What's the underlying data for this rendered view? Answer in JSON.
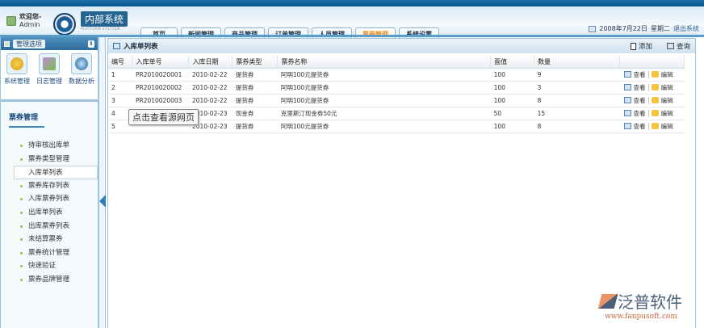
{
  "header": {
    "welcome": "欢迎您-",
    "user": "Admin",
    "system_title": "内部系统",
    "system_subtitle": "PLATFORM SYSYTEM",
    "date": "2008年7月22日",
    "weekday": "星期二",
    "logout": "退出系统"
  },
  "tabs": [
    {
      "label": "首页"
    },
    {
      "label": "新闻管理"
    },
    {
      "label": "商品管理"
    },
    {
      "label": "订单管理"
    },
    {
      "label": "人员管理"
    },
    {
      "label": "票券管理",
      "active": true
    },
    {
      "label": "系统设置"
    }
  ],
  "sidebar": {
    "title": "管理选项",
    "quick": [
      {
        "label": "系统管理"
      },
      {
        "label": "日志管理"
      },
      {
        "label": "数据分析"
      }
    ],
    "section": "票券管理",
    "items": [
      {
        "label": "待审核出库单"
      },
      {
        "label": "票券类型管理"
      },
      {
        "label": "入库单列表",
        "selected": true
      },
      {
        "label": "票券库存列表"
      },
      {
        "label": "入库票券列表"
      },
      {
        "label": "出库单列表"
      },
      {
        "label": "出库票券列表"
      },
      {
        "label": "未结算票券"
      },
      {
        "label": "票券统计管理"
      },
      {
        "label": "快速验证"
      },
      {
        "label": "票券品牌管理"
      }
    ]
  },
  "panel": {
    "title": "入库单列表",
    "add": "添加",
    "query": "查询",
    "view": "查看",
    "edit": "编辑",
    "columns": [
      "编号",
      "入库单号",
      "入库日期",
      "票券类型",
      "票券名称",
      "面值",
      "数量",
      ""
    ],
    "rows": [
      [
        "1",
        "PR2010020001",
        "2010-02-22",
        "提货券",
        "阿明100元提货券",
        "100",
        "9"
      ],
      [
        "2",
        "PR2010020002",
        "2010-02-22",
        "提货券",
        "阿明100元提货券",
        "100",
        "3"
      ],
      [
        "3",
        "PR2010020003",
        "2010-02-22",
        "提货券",
        "阿明100元提货券",
        "100",
        "8"
      ],
      [
        "4",
        "",
        "2010-02-23",
        "现金券",
        "克里斯汀现金券50元",
        "50",
        "15"
      ],
      [
        "5",
        "",
        "2010-02-23",
        "提货券",
        "阿明100元提货券",
        "100",
        "8"
      ]
    ]
  },
  "tooltip": "点击查看源网页",
  "watermark": {
    "name": "泛普软件",
    "url": "www.fanpusoft.com"
  }
}
